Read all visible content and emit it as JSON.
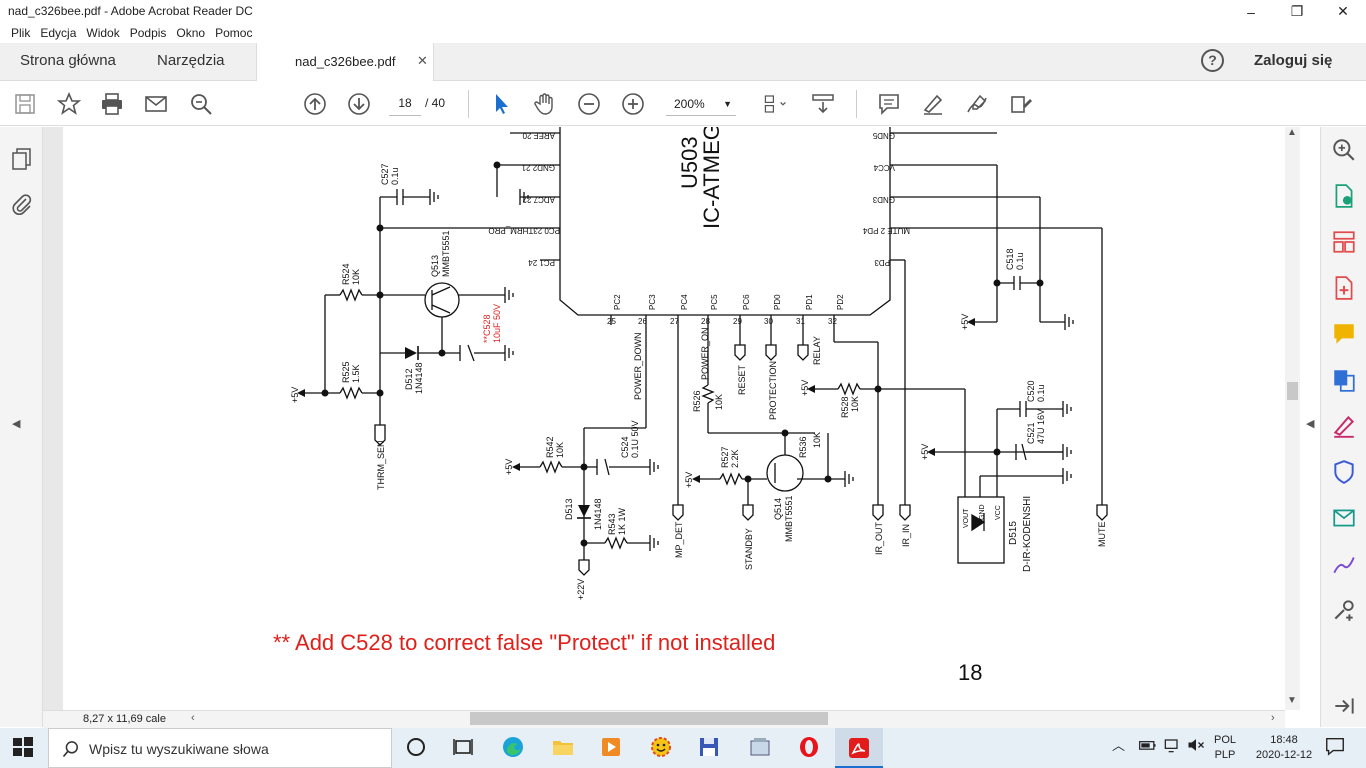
{
  "window": {
    "title": "nad_c326bee.pdf - Adobe Acrobat Reader DC",
    "minimize": "–",
    "maximize": "❐",
    "close": "✕"
  },
  "menu": [
    "Plik",
    "Edycja",
    "Widok",
    "Podpis",
    "Okno",
    "Pomoc"
  ],
  "tabs": {
    "home": "Strona główna",
    "tools": "Narzędzia",
    "document": "nad_c326bee.pdf",
    "close": "✕"
  },
  "header": {
    "help": "?",
    "login": "Zaloguj się"
  },
  "toolbar": {
    "page_current": "18",
    "page_total": "/ 40",
    "zoom": "200%"
  },
  "status": {
    "page_size": "8,27 x 11,69 cale"
  },
  "schematic": {
    "chip_name": "U503",
    "chip_type": "IC-ATMEGA",
    "pins_left": [
      "AREF 20",
      "GND2 21",
      "ADC7 22",
      "PC0 23THRM_PRO",
      "PC1 24"
    ],
    "pins_right": [
      "GND5",
      "VCC4",
      "GND3",
      "MUTE 2 PD4",
      "PD3"
    ],
    "pins_bottom": [
      "PC2",
      "PC3",
      "PC4",
      "PC5",
      "PC6",
      "PD0",
      "PD1",
      "PD2"
    ],
    "pin_numbers_bottom": [
      "25",
      "26",
      "27",
      "28",
      "29",
      "30",
      "31",
      "32"
    ],
    "components": {
      "c527": "C527",
      "c527_val": "0.1u",
      "r524": "R524",
      "r524_val": "10K",
      "q513": "Q513",
      "q513_val": "MMBT5551",
      "c528": "**C528",
      "c528_val": "10uF 50V",
      "r525": "R525",
      "r525_val": "1.5K",
      "d512": "D512",
      "d512_val": "1N4148",
      "thrm_sen": "THRM_SEN",
      "power_down": "POWER_DOWN",
      "power_on": "POWER_ON",
      "reset": "RESET",
      "protection": "PROTECTION",
      "relay": "RELAY",
      "r526": "R526",
      "r526_val": "10K",
      "r542": "R542",
      "r542_val": "10K",
      "c524": "C524",
      "c524_val": "0.1U 50V",
      "d513": "D513",
      "d513_val": "1N4148",
      "r543": "R543",
      "r543_val": "1K 1W",
      "v22": "+22V",
      "mp_det": "MP_DET",
      "r527": "R527",
      "r527_val": "2.2K",
      "standby": "STANDBY",
      "q514": "Q514",
      "q514_val": "MMBT5551",
      "r536": "R536",
      "r536_val": "10K",
      "r528": "R528",
      "r528_val": "10K",
      "ir_out": "IR_OUT",
      "ir_in": "IR_IN",
      "c518": "C518",
      "c518_val": "0.1u",
      "c520": "C520",
      "c520_val": "0.1u",
      "c521": "C521",
      "c521_val": "47U 16V",
      "d515": "D515",
      "d515_val": "D-IR-KODENSHI",
      "vout": "VOUT",
      "gnd": "GND",
      "vcc": "VCC",
      "mute": "MUTE",
      "p5v": "+5V"
    },
    "note": "** Add C528 to correct false \"Protect\" if not installed",
    "page_number": "18"
  },
  "taskbar": {
    "search_placeholder": "Wpisz tu wyszukiwane słowa",
    "lang_top": "POL",
    "lang_bottom": "PLP",
    "time": "18:48",
    "date": "2020-12-12"
  }
}
